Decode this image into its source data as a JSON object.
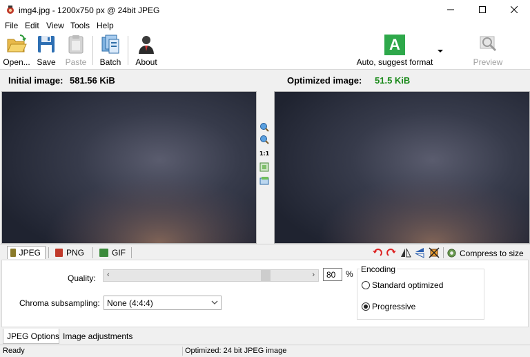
{
  "window": {
    "title": "img4.jpg - 1200x750 px @ 24bit JPEG"
  },
  "menu": [
    "File",
    "Edit",
    "View",
    "Tools",
    "Help"
  ],
  "toolbar": {
    "open": "Open...",
    "save": "Save",
    "paste": "Paste",
    "batch": "Batch",
    "about": "About",
    "format": "Auto, suggest format",
    "format_letter": "A",
    "preview": "Preview"
  },
  "sizes": {
    "initial_label": "Initial image:",
    "initial_value": "581.56 KiB",
    "optimized_label": "Optimized image:",
    "optimized_value": "51.5 KiB"
  },
  "zoom": {
    "one_to_one": "1:1"
  },
  "format_tabs": [
    "JPEG",
    "PNG",
    "GIF"
  ],
  "compress": "Compress to size",
  "options": {
    "quality_label": "Quality:",
    "quality_value": "80",
    "quality_unit": "%",
    "chroma_label": "Chroma subsampling:",
    "chroma_value": "None (4:4:4)",
    "encoding_title": "Encoding",
    "encoding_options": [
      {
        "label": "Standard optimized",
        "selected": false
      },
      {
        "label": "Progressive",
        "selected": true
      }
    ]
  },
  "bottom_tabs": [
    "JPEG Options",
    "Image adjustments"
  ],
  "status": {
    "left": "Ready",
    "right": "Optimized: 24 bit JPEG image"
  },
  "colors": {
    "optimized_value": "#1a8a1a",
    "format_button": "#2ea84a"
  }
}
